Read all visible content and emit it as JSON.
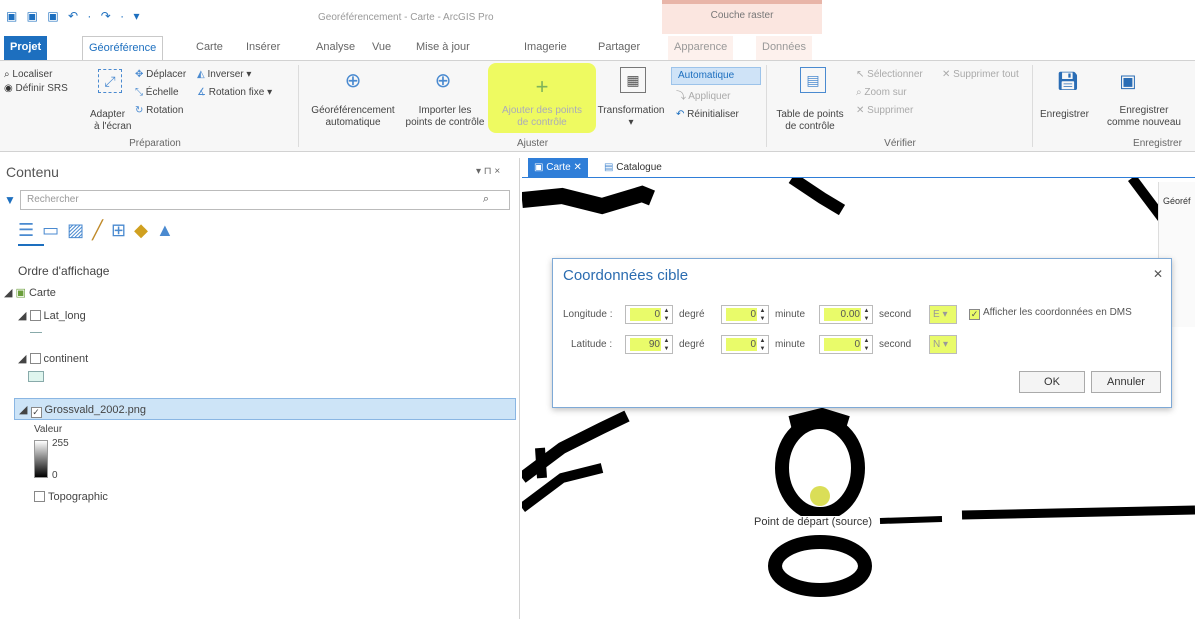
{
  "window": {
    "title": "Georéférencement - Carte - ArcGIS Pro",
    "context_group": "Couche raster"
  },
  "tabs": [
    "Projet",
    "Géoréférence",
    "Carte",
    "Insérer",
    "Analyse",
    "Vue",
    "Mise à jour",
    "Imagerie",
    "Partager",
    "Apparence",
    "Données"
  ],
  "ribbon": {
    "preparation": {
      "localiser": "Localiser",
      "definir_srs": "Définir SRS",
      "adapter": "Adapter",
      "a_lecran": "à l'écran",
      "deplacer": "Déplacer",
      "echelle": "Échelle",
      "rotation": "Rotation",
      "inverser": "Inverser",
      "rotation_fixe": "Rotation fixe",
      "group": "Préparation"
    },
    "ajuster": {
      "geo_auto_1": "Géoréférencement",
      "geo_auto_2": "automatique",
      "importer_1": "Importer les",
      "importer_2": "points de contrôle",
      "ajouter_1": "Ajouter des points",
      "ajouter_2": "de contrôle",
      "transformation": "Transformation",
      "automatique": "Automatique",
      "appliquer": "Appliquer",
      "reinitialiser": "Réinitialiser",
      "group": "Ajuster"
    },
    "verifier": {
      "table_1": "Table de points",
      "table_2": "de contrôle",
      "selectionner": "Sélectionner",
      "supprimer_tout": "Supprimer tout",
      "zoom_sur": "Zoom sur",
      "supprimer": "Supprimer",
      "group": "Vérifier"
    },
    "enregistrer": {
      "enregistrer": "Enregistrer",
      "enreg_nouveau_1": "Enregistrer",
      "enreg_nouveau_2": "comme nouveau",
      "group": "Enregistrer"
    }
  },
  "contents": {
    "title": "Contenu",
    "search_placeholder": "Rechercher",
    "order_label": "Ordre d'affichage",
    "pane_controls": "▾ ⊓ ×",
    "items": {
      "carte": "Carte",
      "lat_long": "Lat_long",
      "continent": "continent",
      "raster": "Grossvald_2002.png",
      "valeur": "Valeur",
      "val_max": "255",
      "val_min": "0",
      "topographic": "Topographic"
    }
  },
  "map_tabs": [
    "Carte",
    "Catalogue"
  ],
  "map": {
    "source_label": "Point de départ (source)",
    "side_peek": "Géoréf"
  },
  "dialog": {
    "title": "Coordonnées cible",
    "longitude_label": "Longitude :",
    "latitude_label": "Latitude :",
    "degre": "degré",
    "minute": "minute",
    "second": "second",
    "lon_deg": "0",
    "lon_min": "0",
    "lon_sec": "0.00",
    "lon_dir": "E",
    "lat_deg": "90",
    "lat_min": "0",
    "lat_sec": "0",
    "lat_dir": "N",
    "dms_label": "Afficher les coordonnées en DMS",
    "ok": "OK",
    "annuler": "Annuler"
  },
  "colors": {
    "accent": "#1d6fbf",
    "highlight": "#e9fb6a",
    "context_tab": "#e8b5a8"
  }
}
